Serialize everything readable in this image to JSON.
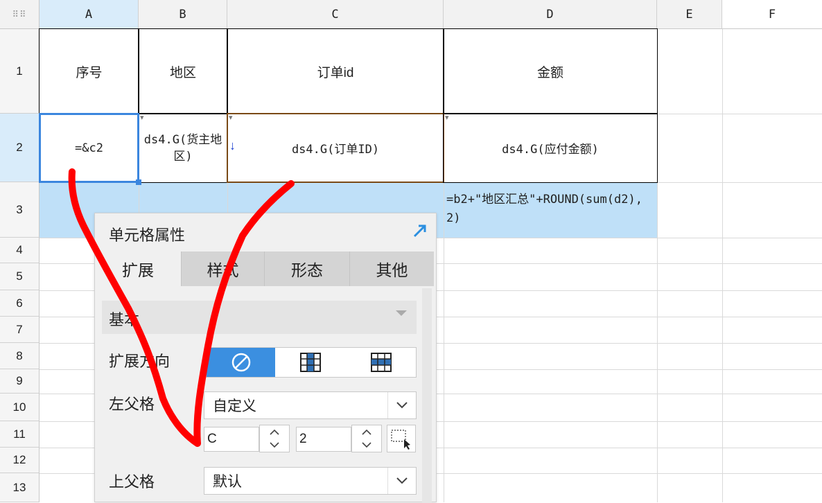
{
  "columns": [
    "A",
    "B",
    "C",
    "D",
    "E",
    "F"
  ],
  "rows": [
    "1",
    "2",
    "3",
    "4",
    "5",
    "6",
    "7",
    "8",
    "9",
    "10",
    "11",
    "12",
    "13"
  ],
  "cells": {
    "A1": "序号",
    "B1": "地区",
    "C1": "订单id",
    "D1": "金额",
    "A2": "=&c2",
    "B2": "ds4.G(货主地区)",
    "C2": "ds4.G(订单ID)",
    "D2": "ds4.G(应付金额)",
    "D3": "=b2+\"地区汇总\"+ROUND(sum(d2),2)"
  },
  "panel": {
    "title": "单元格属性",
    "tabs": [
      "扩展",
      "样式",
      "形态",
      "其他"
    ],
    "active_tab": "扩展",
    "section": "基本",
    "expand_direction_label": "扩展方向",
    "expand_direction_selected": "none",
    "left_parent_label": "左父格",
    "left_parent_value": "自定义",
    "left_parent_col": "C",
    "left_parent_row": "2",
    "top_parent_label": "上父格",
    "top_parent_value": "默认"
  },
  "colors": {
    "selection_border": "#3b86de",
    "selection_fill": "#bfe0f8",
    "active_button": "#3b8fe0",
    "annotation": "#ff0000",
    "c2_border": "#7a4a16"
  }
}
